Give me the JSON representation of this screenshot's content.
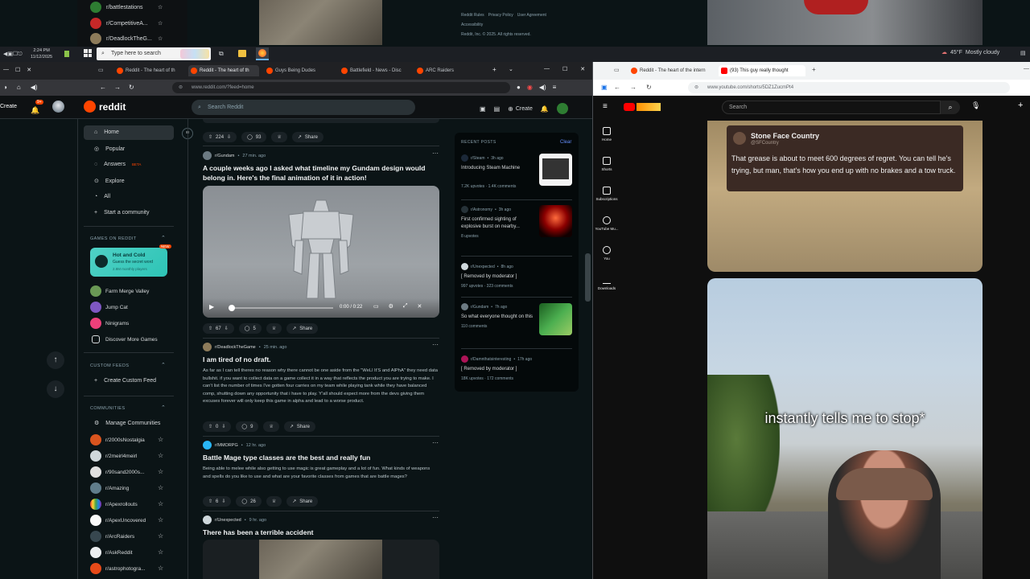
{
  "top_strip": {
    "communities": [
      "r/battlestations",
      "r/CompetitiveA...",
      "r/DeadlockTheG..."
    ],
    "footer_links": [
      "Reddit Rules",
      "Privacy Policy",
      "User Agreement",
      "Accessibility"
    ],
    "copyright": "Reddit, Inc. © 2025. All rights reserved."
  },
  "taskbar": {
    "time": "2:24 PM",
    "date": "11/12/2025",
    "search_placeholder": "Type here to search",
    "weather_temp": "45°F",
    "weather_desc": "Mostly cloudy"
  },
  "left_browser": {
    "tabs": [
      "Reddit - The heart of th",
      "Reddit - The heart of th",
      "Guys Being Dudes",
      "Battlefield - News - Disc",
      "ARC Raiders"
    ],
    "url": "www.reddit.com/?feed=home"
  },
  "right_browser": {
    "tabs": [
      "Reddit - The heart of the intern",
      "(93) This guy really thought"
    ],
    "url": "www.youtube.com/shorts/5DZ1ZucmPt4"
  },
  "reddit": {
    "logo": "reddit",
    "search_placeholder": "Search Reddit",
    "create_left": "Create",
    "notif_badge": "9+",
    "create_label": "Create",
    "nav": [
      "Home",
      "Popular",
      "Answers",
      "Explore",
      "All",
      "Start a community"
    ],
    "answers_badge": "BETA",
    "games_header": "GAMES ON REDDIT",
    "featured_game": {
      "title": "Hot and Cold",
      "sub": "Guess the secret word",
      "players": "2.8M monthly players",
      "badge": "NEW"
    },
    "games": [
      "Farm Merge Valley",
      "Jump Cat",
      "Ninigrams",
      "Discover More Games"
    ],
    "custom_header": "CUSTOM FEEDS",
    "custom_create": "Create Custom Feed",
    "communities_header": "COMMUNITIES",
    "manage": "Manage Communities",
    "communities": [
      "r/2000sNostalgia",
      "r/2meirl4meirl",
      "r/90sand2000s...",
      "r/Amazing",
      "r/Apexrollouts",
      "r/ApexUncovered",
      "r/ArcRaiders",
      "r/AskReddit",
      "r/astrophotogra..."
    ],
    "posts": [
      {
        "votes": "224",
        "comments": "93",
        "share": "Share"
      },
      {
        "sub": "r/Gundam",
        "time": "27 min. ago",
        "title": "A couple weeks ago I asked what timeline my Gundam design would belong in. Here's the final animation of it in action!",
        "video_time": "0:00 / 0:22",
        "votes": "67",
        "comments": "5",
        "share": "Share"
      },
      {
        "sub": "r/DeadlockTheGame",
        "time": "25 min. ago",
        "title": "I am tired of no draft.",
        "body": "As far as I can tell theres no reason why there cannot be one aside from the \"WeLl It'S and AlPhA\" they need data bullshit. if you want to collect data on a game collect it in a way that reflects the product you are trying to make. I can't list the number of times I've gotten four carries on my team while playing tank while they have balanced comp, shutting down any opportunity that i have to play. Y'all should expect more from the devs giving them excuses forever will only keep this game in alpha and lead to a worse product.",
        "votes": "0",
        "comments": "9",
        "share": "Share"
      },
      {
        "sub": "r/MMORPG",
        "time": "12 hr. ago",
        "title": "Battle Mage type classes are the best and really fun",
        "body": "Being able to melee while also getting to use magic is great gameplay and a lot of fun. What kinds of weapons and spells do you like to use and what are your favorite classes from games that are battle mages?",
        "votes": "6",
        "comments": "26",
        "share": "Share"
      },
      {
        "sub": "r/Unexpected",
        "time": "9 hr. ago",
        "title": "There has been a terrible accident"
      }
    ],
    "recent": {
      "header": "RECENT POSTS",
      "clear": "Clear",
      "items": [
        {
          "sub": "r/Steam",
          "time": "3h ago",
          "title": "Introducing Steam Machine",
          "stats": "7.2K upvotes · 1.4K comments"
        },
        {
          "sub": "r/Astronomy",
          "time": "3h ago",
          "title": "First confirmed sighting of explosive burst on nearby...",
          "stats": "8 upvotes"
        },
        {
          "sub": "r/Unexpected",
          "time": "8h ago",
          "title": "[ Removed by moderator ]",
          "stats": "997 upvotes · 323 comments"
        },
        {
          "sub": "r/Gundam",
          "time": "7h ago",
          "title": "So what everyone thought on this",
          "stats": "110 comments"
        },
        {
          "sub": "r/Damnthatsinteresting",
          "time": "17h ago",
          "title": "[ Removed by moderator ]",
          "stats": "18K upvotes · 172 comments"
        }
      ]
    }
  },
  "youtube": {
    "search_placeholder": "Search",
    "nav": [
      "Home",
      "Shorts",
      "Subscriptions",
      "YouTube Mu...",
      "You",
      "Downloads"
    ],
    "tweet": {
      "name": "Stone Face Country",
      "handle": "@SFCountry",
      "text": "That grease is about to meet 600 degrees of regret. You can tell he's trying, but man, that's how you end up with no brakes and a tow truck."
    },
    "caption": "instantly tells me to stop*"
  }
}
